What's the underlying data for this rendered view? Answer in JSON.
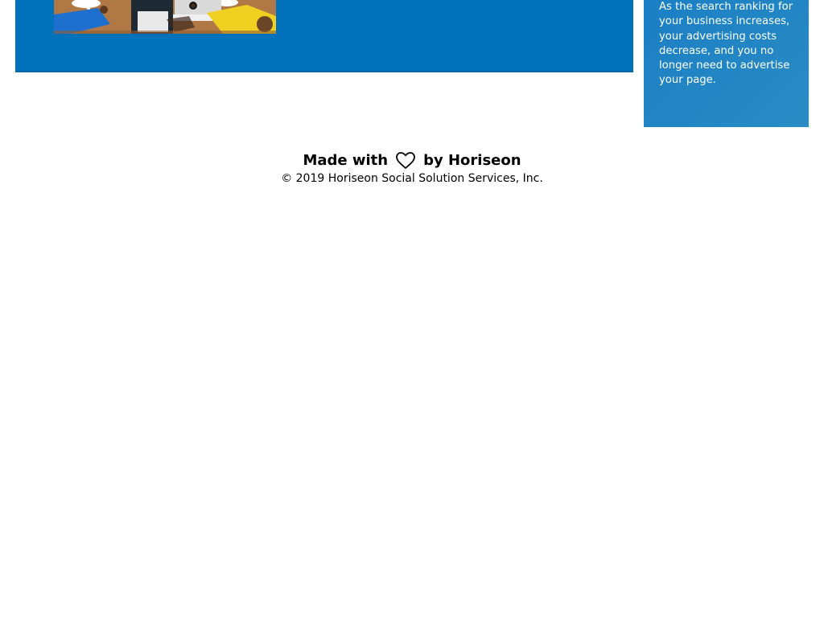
{
  "main": {
    "image_alt": "people collaborating around a table with speech bubbles"
  },
  "sidebar": {
    "text": "As the search ranking for your business increases, your advertising costs decrease, and you no longer need to advertise your page."
  },
  "footer": {
    "made_with": "Made with",
    "by": "by Horiseon",
    "heart_icon": "heart-icon",
    "copyright": "© 2019 Horiseon Social Solution Services, Inc."
  },
  "colors": {
    "main_panel": "#0072bb",
    "side_panel": "#2589bd",
    "text": "#000000"
  }
}
